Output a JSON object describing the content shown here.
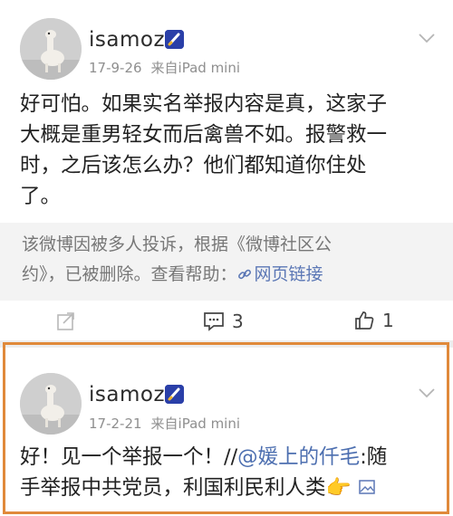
{
  "post1": {
    "username": "isamoz",
    "date": "17-9-26",
    "source": "来自iPad mini",
    "lines": [
      "好可怕。如果实名举报内容是真，这家子",
      "大概是重男轻女而后禽兽不如。报警救一",
      "时，之后该怎么办？他们都知道你住处",
      "了。"
    ],
    "notice_line1": "该微博因被多人投诉，根据《微博社区公",
    "notice_line2": "约》，已被删除。查看帮助：",
    "notice_link": "网页链接",
    "comments": "3",
    "likes": "1"
  },
  "post2": {
    "username": "isamoz",
    "date": "17-2-21",
    "source": "来自iPad mini",
    "line1_prefix": "好！见一个举报一个！//",
    "mention": "@媛上的仟毛",
    "line1_suffix": ":随",
    "line2": "手举报中共党员，利国利民利人类",
    "emoji": "👉"
  },
  "icons": {
    "avatar": "avatar-alpaca",
    "vip": "vip-badge-icon",
    "more": "chevron-down-icon",
    "repost": "repost-icon",
    "comment": "comment-icon",
    "like": "thumbs-up-icon",
    "link": "link-icon",
    "image": "image-icon"
  },
  "colors": {
    "highlight_border": "#e0893a",
    "link": "#5b77b5",
    "vip": "#2a3fa8"
  }
}
